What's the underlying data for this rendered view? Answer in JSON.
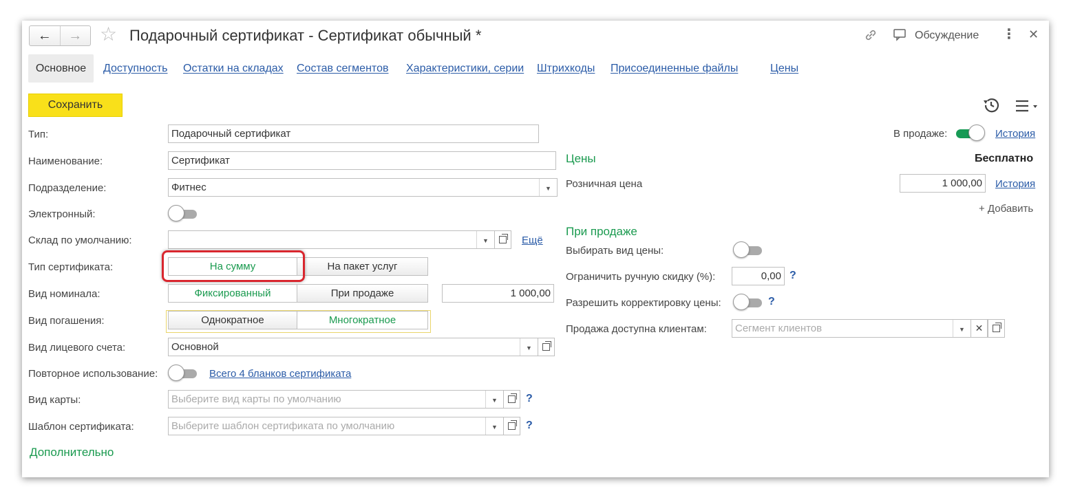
{
  "window": {
    "title": "Подарочный сертификат - Сертификат обычный *",
    "discussion_label": "Обсуждение"
  },
  "tabs": [
    {
      "label": "Основное",
      "active": true
    },
    {
      "label": "Доступность"
    },
    {
      "label": "Остатки на складах"
    },
    {
      "label": "Состав сегментов"
    },
    {
      "label": "Характеристики, серии"
    },
    {
      "label": "Штрихкоды"
    },
    {
      "label": "Присоединенные файлы"
    },
    {
      "label": "Цены"
    }
  ],
  "toolbar": {
    "save_label": "Сохранить"
  },
  "form": {
    "type": {
      "label": "Тип:",
      "value": "Подарочный сертификат"
    },
    "name": {
      "label": "Наименование:",
      "value": "Сертификат"
    },
    "division": {
      "label": "Подразделение:",
      "value": "Фитнес"
    },
    "electronic": {
      "label": "Электронный:",
      "on": false
    },
    "warehouse": {
      "label": "Склад по умолчанию:",
      "value": "",
      "more_link": "Ещё"
    },
    "cert_type": {
      "label": "Тип сертификата:",
      "options": [
        "На сумму",
        "На пакет услуг"
      ],
      "selected": 0
    },
    "nominal_type": {
      "label": "Вид номинала:",
      "options": [
        "Фиксированный",
        "При продаже"
      ],
      "selected": 0,
      "amount": "1 000,00"
    },
    "redemption": {
      "label": "Вид погашения:",
      "options": [
        "Однократное",
        "Многократное"
      ],
      "selected": 1
    },
    "account_type": {
      "label": "Вид лицевого счета:",
      "value": "Основной"
    },
    "reuse": {
      "label": "Повторное использование:",
      "on": false,
      "link": "Всего 4 бланков сертификата"
    },
    "card_type": {
      "label": "Вид карты:",
      "placeholder": "Выберите вид карты по умолчанию"
    },
    "template": {
      "label": "Шаблон сертификата:",
      "placeholder": "Выберите шаблон сертификата по умолчанию"
    },
    "additional": "Дополнительно"
  },
  "right": {
    "on_sale": {
      "label": "В продаже:",
      "on": true,
      "history": "История"
    },
    "prices": {
      "heading": "Цены",
      "free_label": "Бесплатно",
      "retail_label": "Розничная цена",
      "retail_value": "1 000,00",
      "history": "История",
      "add": "+ Добавить"
    },
    "on_sale_section": {
      "heading": "При продаже",
      "choose_price": {
        "label": "Выбирать вид цены:",
        "on": false
      },
      "limit_discount": {
        "label": "Ограничить ручную скидку (%):",
        "value": "0,00",
        "help": "?"
      },
      "allow_adjust": {
        "label": "Разрешить корректировку цены:",
        "on": false,
        "help": "?"
      },
      "clients": {
        "label": "Продажа доступна клиентам:",
        "placeholder": "Сегмент клиентов"
      }
    }
  },
  "help": "?"
}
